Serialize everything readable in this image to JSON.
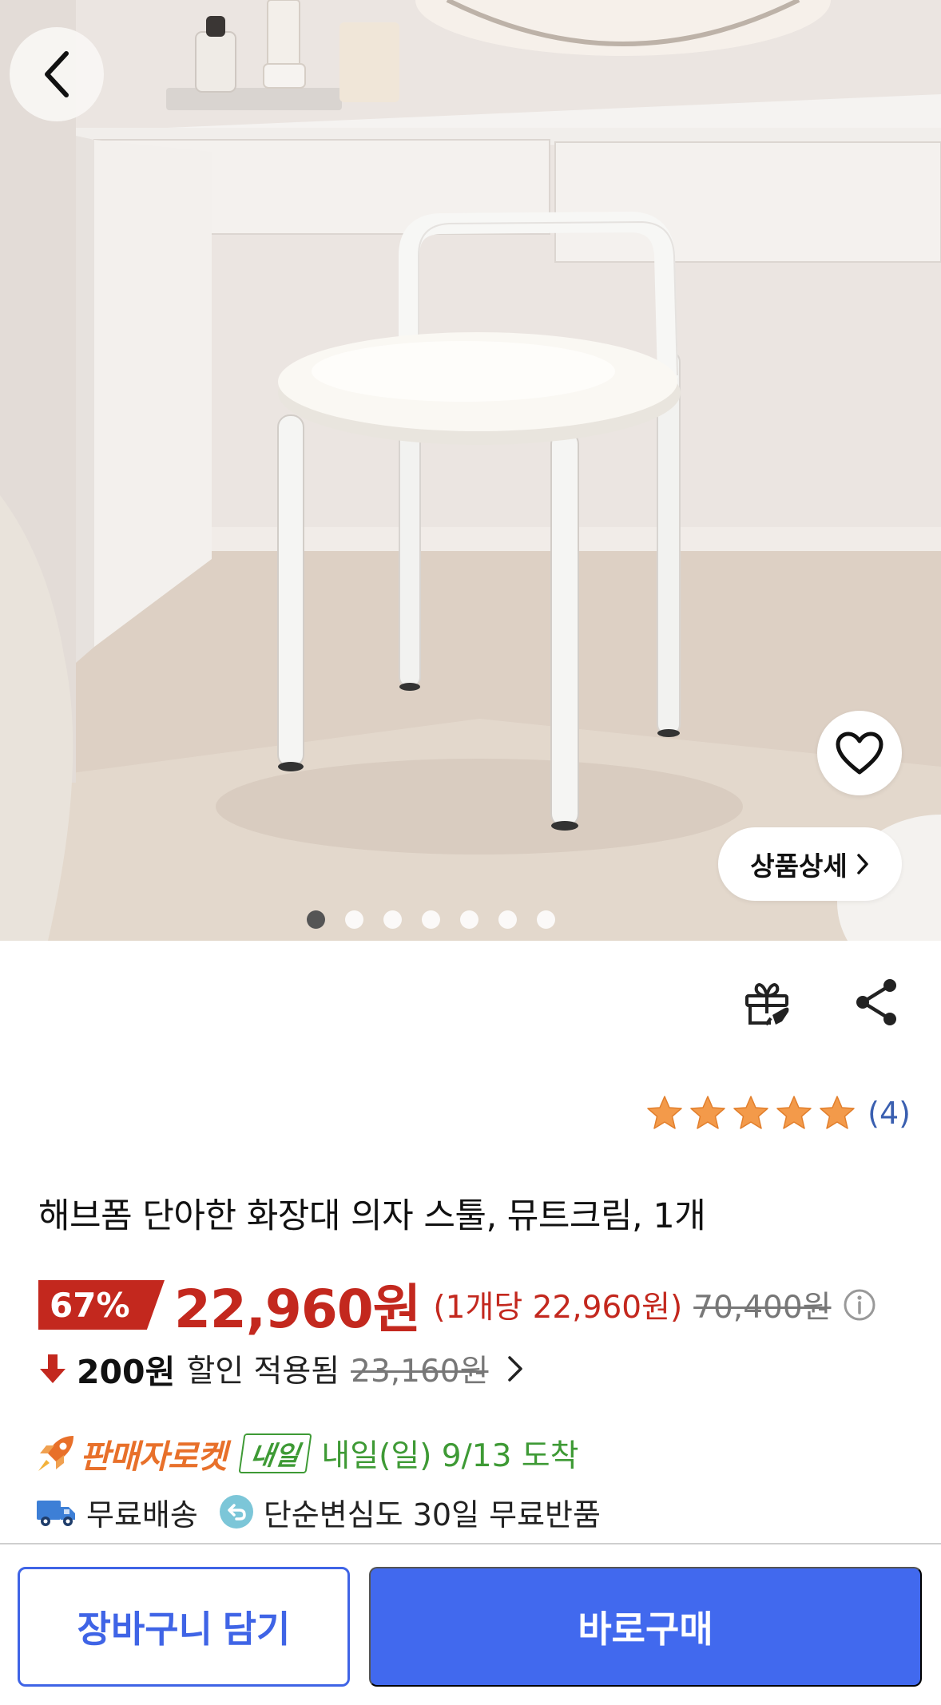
{
  "product": {
    "title": "해브폼 단아한 화장대 의자 스툴, 뮤트크림, 1개",
    "image_alt": "White vanity stool with cream cushion in front of a white vanity desk",
    "image_count": 7,
    "active_image_index": 0
  },
  "gallery": {
    "detail_label": "상품상세"
  },
  "rating": {
    "stars": 5,
    "review_count": "(4)"
  },
  "price": {
    "discount_rate": "67%",
    "sale_price": "22,960원",
    "unit_price": "(1개당 22,960원)",
    "original_price": "70,400원"
  },
  "coupon": {
    "amount": "200원",
    "label": "할인 적용됨",
    "before_price": "23,160원"
  },
  "delivery": {
    "rocket_label": "판매자로켓",
    "tomorrow_badge": "내일",
    "arrival_text": "내일(일) 9/13 도착",
    "free_shipping": "무료배송",
    "return_policy": "단순변심도 30일 무료반품"
  },
  "actions": {
    "cart_label": "장바구니 담기",
    "buy_label": "바로구매"
  },
  "colors": {
    "sale_red": "#c3281e",
    "primary_blue": "#4169ee",
    "rating_star": "#f39a4a",
    "rocket_orange": "#e8702a",
    "delivery_green": "#3e9a35"
  },
  "icons": [
    "back-chevron-icon",
    "heart-icon",
    "gift-icon",
    "share-icon",
    "info-icon",
    "arrow-down-icon",
    "chevron-right-icon",
    "rocket-icon",
    "truck-icon",
    "return-icon"
  ]
}
